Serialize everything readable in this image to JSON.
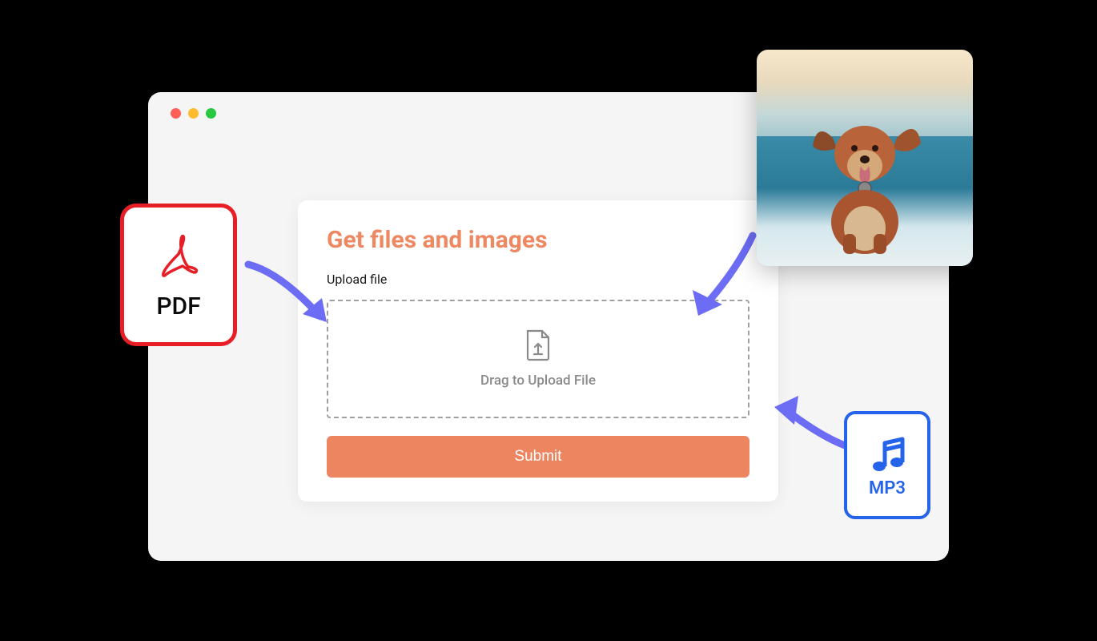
{
  "card": {
    "title": "Get files and images",
    "upload_label": "Upload file",
    "dropzone_text": "Drag to Upload File",
    "submit_label": "Submit"
  },
  "badges": {
    "pdf": "PDF",
    "mp3": "MP3"
  },
  "colors": {
    "accent": "#ed8962",
    "pdf_red": "#e71e25",
    "mp3_blue": "#2563eb",
    "arrow": "#6c6cf5"
  }
}
